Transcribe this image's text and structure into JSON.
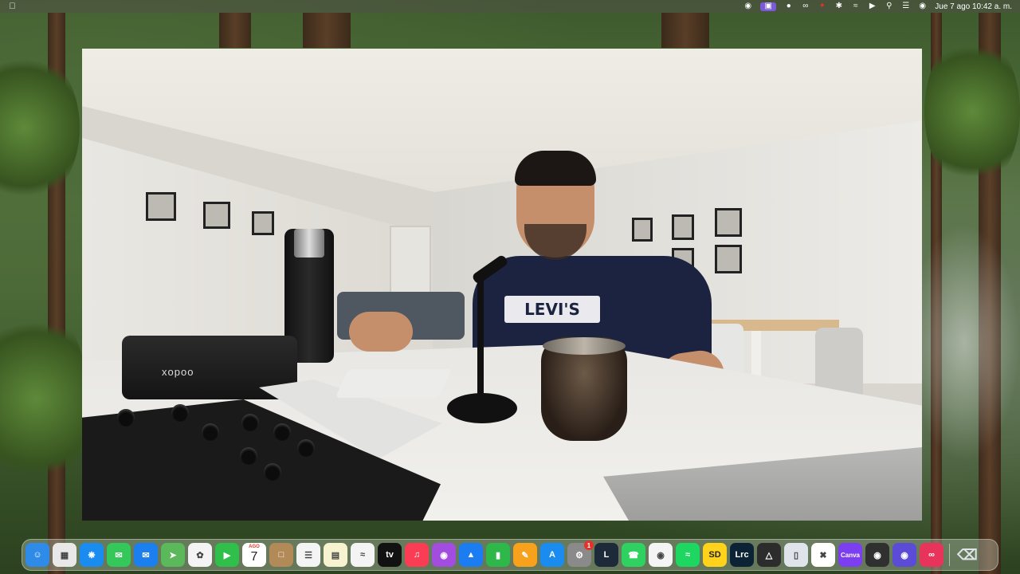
{
  "menubar": {
    "date_time": "Jue 7 ago  10:42 a. m.",
    "icons": [
      "apple-logo",
      "stats-icon",
      "screen-mirror-icon",
      "leaf-icon",
      "creative-cloud-icon",
      "cleanmaster-icon",
      "bluetooth-icon",
      "wifi-icon",
      "play-icon",
      "search-icon",
      "control-center-icon",
      "siri-icon"
    ]
  },
  "video": {
    "shirt_text": "LEVI'S",
    "camera_brand": "xopoo"
  },
  "dock": {
    "apps": [
      {
        "name": "Finder",
        "icon": "finder-icon",
        "color": "#2e8ce8"
      },
      {
        "name": "Launchpad",
        "icon": "launchpad-icon",
        "color": "#e8e8e8"
      },
      {
        "name": "Safari",
        "icon": "safari-icon",
        "color": "#1a8cf0"
      },
      {
        "name": "Messages",
        "icon": "messages-icon",
        "color": "#34c759"
      },
      {
        "name": "Mail",
        "icon": "mail-icon",
        "color": "#1b7ff0"
      },
      {
        "name": "Maps",
        "icon": "maps-icon",
        "color": "#5bb85b"
      },
      {
        "name": "Photos",
        "icon": "photos-icon",
        "color": "#f4f4f4"
      },
      {
        "name": "FaceTime",
        "icon": "facetime-icon",
        "color": "#2fbf4a"
      },
      {
        "name": "Calendar",
        "icon": "calendar-icon",
        "color": "#ffffff",
        "month": "AGO",
        "day": "7"
      },
      {
        "name": "Notes Folder",
        "icon": "notes-folder-icon",
        "color": "#b28a57"
      },
      {
        "name": "Reminders",
        "icon": "reminders-icon",
        "color": "#f4f4f4"
      },
      {
        "name": "Notes",
        "icon": "notes-icon",
        "color": "#f7f2d0"
      },
      {
        "name": "Freeform",
        "icon": "freeform-icon",
        "color": "#f4f4f4"
      },
      {
        "name": "Apple TV",
        "icon": "tv-icon",
        "color": "#111111",
        "label": "tv"
      },
      {
        "name": "Music",
        "icon": "music-icon",
        "color": "#fa3c55"
      },
      {
        "name": "Podcasts",
        "icon": "podcasts-icon",
        "color": "#a24de0"
      },
      {
        "name": "Keynote",
        "icon": "keynote-icon",
        "color": "#1c7cf2"
      },
      {
        "name": "Numbers",
        "icon": "numbers-icon",
        "color": "#2eb84a"
      },
      {
        "name": "Pages",
        "icon": "pages-icon",
        "color": "#f7a11c"
      },
      {
        "name": "App Store",
        "icon": "app-store-icon",
        "color": "#1a8cf0"
      },
      {
        "name": "System Settings",
        "icon": "settings-icon",
        "color": "#8a8a8a",
        "badge": "1"
      },
      {
        "name": "League of Legends",
        "icon": "league-icon",
        "color": "#1c2a3a"
      },
      {
        "name": "WhatsApp",
        "icon": "whatsapp-icon",
        "color": "#2fd160"
      },
      {
        "name": "Chrome",
        "icon": "chrome-icon",
        "color": "#f4f4f4"
      },
      {
        "name": "Spotify",
        "icon": "spotify-icon",
        "color": "#1ed760"
      },
      {
        "name": "SD",
        "icon": "sd-icon",
        "color": "#ffd21c",
        "label": "SD"
      },
      {
        "name": "Lightroom Classic",
        "icon": "lightroom-icon",
        "color": "#0b2334",
        "label": "Lrc"
      },
      {
        "name": "Affinity",
        "icon": "affinity-icon",
        "color": "#2c2c2c"
      },
      {
        "name": "Phone",
        "icon": "phone-icon",
        "color": "#dfe4ea"
      },
      {
        "name": "CapCut",
        "icon": "capcut-icon",
        "color": "#ffffff"
      },
      {
        "name": "Canva",
        "icon": "canva-icon",
        "color": "#7b3ef0",
        "label": "Canva"
      },
      {
        "name": "OBS",
        "icon": "obs-icon",
        "color": "#303030"
      },
      {
        "name": "Screen Recorder",
        "icon": "recorder-icon",
        "color": "#5b4bd6"
      },
      {
        "name": "Creative Cloud",
        "icon": "creative-cloud-icon",
        "color": "#e8345a"
      },
      {
        "name": "Trash",
        "icon": "trash-icon",
        "color": "transparent"
      }
    ]
  }
}
